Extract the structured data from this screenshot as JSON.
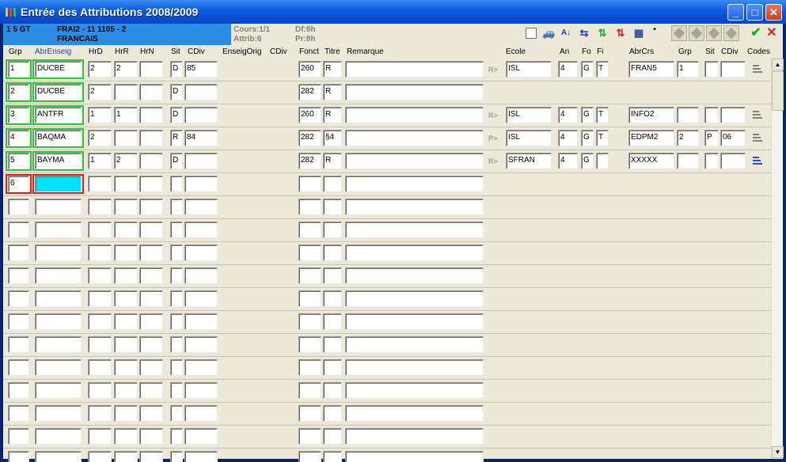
{
  "window": {
    "title": "Entrée des Attributions 2008/2009"
  },
  "info": {
    "line1_left": "1     5 GT",
    "line1_right": "FRAI2 - 11 1105  - 2",
    "line2": "FRANCAIS",
    "cours": "Cours:1/1",
    "attrib": "Attrib:6",
    "df": "Df:8h",
    "pr": "Pr:8h"
  },
  "columns": {
    "grp": "Grp",
    "abrenseig": "AbrEnseig",
    "hrd": "HrD",
    "hrr": "HrR",
    "hrn": "HrN",
    "sit": "Sit",
    "cdiv": "CDiv",
    "enseigorig": "EnseigOrig",
    "cdiv2": "CDiv",
    "fonct": "Fonct",
    "titre": "Titre",
    "remarque": "Remarque",
    "ecole": "Ecole",
    "an": "An",
    "fo": "Fo",
    "fi": "Fi",
    "abrcrs": "AbrCrs",
    "grp2": "Grp",
    "sit2": "Sit",
    "cdiv3": "CDiv",
    "codes": "Codes"
  },
  "rows": [
    {
      "grp": "1",
      "abr": "DUCBE",
      "hrd": "2",
      "hrr": "2",
      "hrn": "",
      "sit": "D",
      "cdiv": "85",
      "fonct": "260",
      "titre": "R",
      "rem": "",
      "arrow": "R>",
      "ecole": "ISL",
      "an": "4",
      "fo": "G",
      "fi": "T",
      "abrcrs": "FRAN5",
      "grp2": "1",
      "sit2": "",
      "cdiv2": "",
      "codes": "gray"
    },
    {
      "grp": "2",
      "abr": "DUCBE",
      "hrd": "2",
      "hrr": "",
      "hrn": "",
      "sit": "D",
      "cdiv": "",
      "fonct": "282",
      "titre": "R",
      "rem": ""
    },
    {
      "grp": "3",
      "abr": "ANTFR",
      "hrd": "1",
      "hrr": "1",
      "hrn": "",
      "sit": "D",
      "cdiv": "",
      "fonct": "260",
      "titre": "R",
      "rem": "",
      "arrow": "R>",
      "ecole": "ISL",
      "an": "4",
      "fo": "G",
      "fi": "T",
      "abrcrs": "INFO2",
      "grp2": "",
      "sit2": "",
      "cdiv2": "",
      "codes": "gray"
    },
    {
      "grp": "4",
      "abr": "BAQMA",
      "hrd": "2",
      "hrr": "",
      "hrn": "",
      "sit": "R",
      "cdiv": "84",
      "fonct": "282",
      "titre": "§4",
      "rem": "",
      "arrow": "P>",
      "ecole": "ISL",
      "an": "4",
      "fo": "G",
      "fi": "T",
      "abrcrs": "EDPM2",
      "grp2": "2",
      "sit2": "P",
      "cdiv2": "06",
      "codes": "gray"
    },
    {
      "grp": "5",
      "abr": "BAYMA",
      "hrd": "1",
      "hrr": "2",
      "hrn": "",
      "sit": "D",
      "cdiv": "",
      "fonct": "282",
      "titre": "R",
      "rem": "",
      "arrow": "R>",
      "ecole": "SFRAN",
      "an": "4",
      "fo": "G",
      "fi": "",
      "abrcrs": "XXXXX",
      "grp2": "",
      "sit2": "",
      "cdiv2": "",
      "codes": "blue"
    },
    {
      "grp": "6",
      "abr": "",
      "hrd": "",
      "hrr": "",
      "hrn": "",
      "sit": "",
      "cdiv": "",
      "fonct": "",
      "titre": "",
      "rem": "",
      "active": true
    }
  ],
  "empty_rows": 12,
  "colors": {
    "title_bar": "#0d5fe6",
    "info_band": "#2c8be3",
    "green_frame": "#2fc43a",
    "red_frame": "#e0201f",
    "active_cell": "#00e0ff"
  },
  "icons": [
    "grid-icon",
    "car-icon",
    "sort-az-icon",
    "swap-icon",
    "green-arrows-icon",
    "red-arrows-icon",
    "calculator-icon",
    "dot-icon",
    "nav-first-icon",
    "nav-prev-icon",
    "nav-next-icon",
    "nav-last-icon",
    "check-icon",
    "cancel-icon"
  ]
}
